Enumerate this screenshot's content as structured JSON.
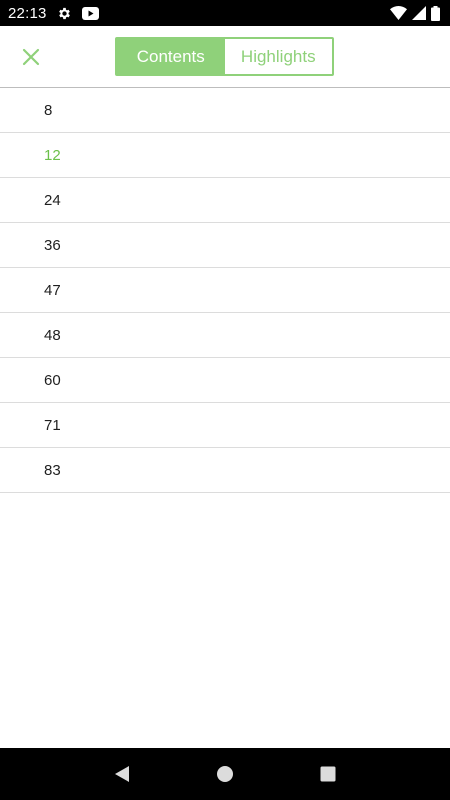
{
  "status_bar": {
    "time": "22:13",
    "left_icons": [
      "gear-icon",
      "youtube-icon"
    ],
    "right_icons": [
      "wifi-icon",
      "cell-signal-icon",
      "battery-icon"
    ]
  },
  "toolbar": {
    "close_icon": "close-icon",
    "tabs": [
      {
        "label": "Contents",
        "active": true
      },
      {
        "label": "Highlights",
        "active": false
      }
    ]
  },
  "contents": {
    "items": [
      {
        "label": "8",
        "current": false
      },
      {
        "label": "12",
        "current": true
      },
      {
        "label": "24",
        "current": false
      },
      {
        "label": "36",
        "current": false
      },
      {
        "label": "47",
        "current": false
      },
      {
        "label": "48",
        "current": false
      },
      {
        "label": "60",
        "current": false
      },
      {
        "label": "71",
        "current": false
      },
      {
        "label": "83",
        "current": false
      }
    ]
  },
  "nav_bar": {
    "buttons": [
      "back-icon",
      "home-icon",
      "recents-icon"
    ]
  },
  "colors": {
    "accent": "#8fd17a",
    "current_item": "#6cc04a",
    "divider": "#dcdcdc"
  }
}
